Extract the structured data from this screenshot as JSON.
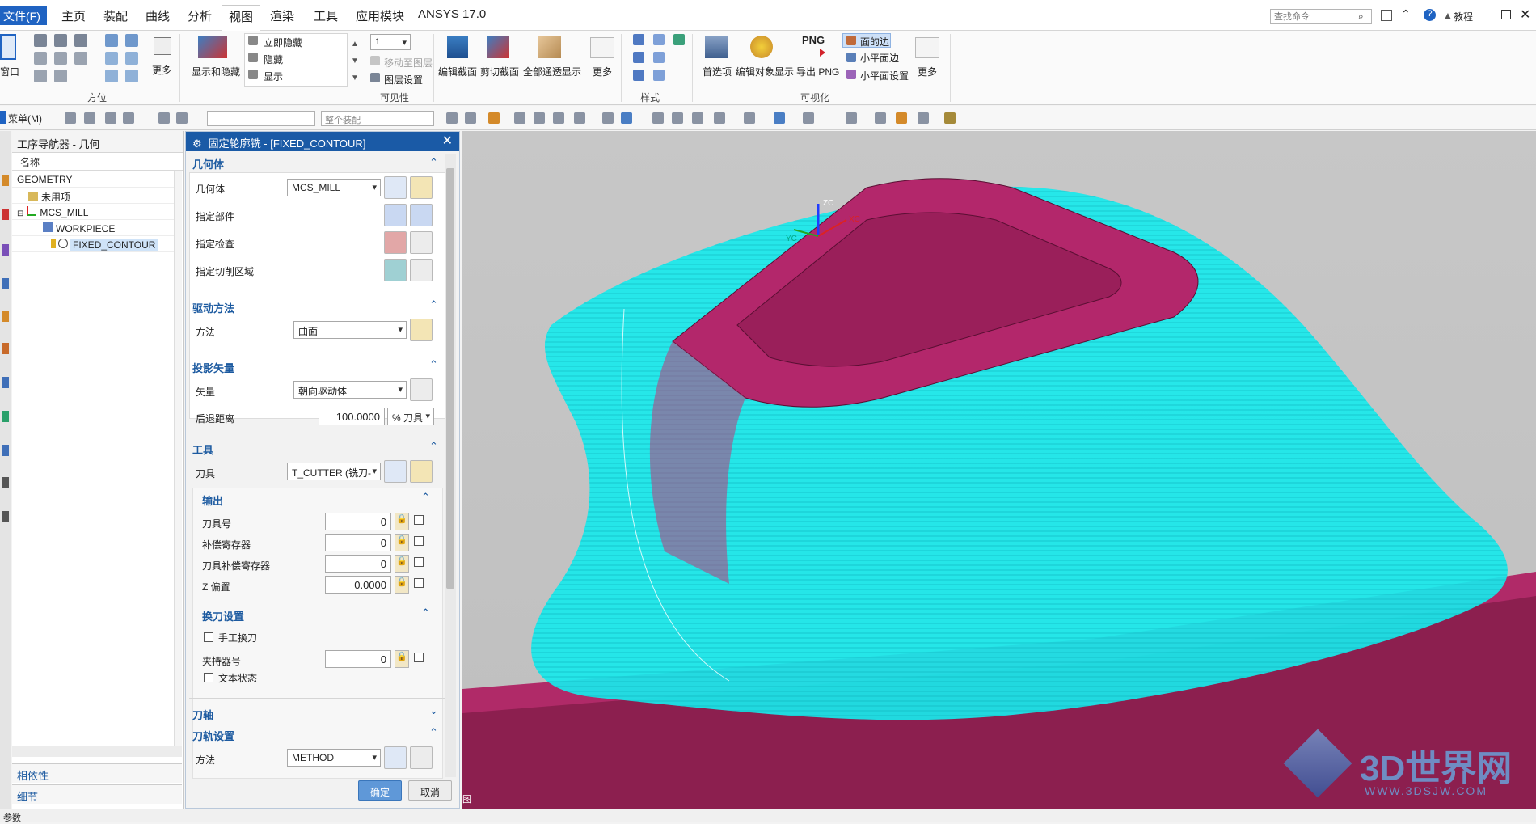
{
  "menubar": {
    "file": "文件(F)",
    "items": [
      "主页",
      "装配",
      "曲线",
      "分析",
      "视图",
      "渲染",
      "工具",
      "应用模块",
      "ANSYS 17.0"
    ],
    "active": "视图",
    "search_placeholder": "查找命令",
    "help": "教程"
  },
  "ribbon": {
    "window_label": "窗口",
    "orient": {
      "more": "更多",
      "label": "方位"
    },
    "visibility": {
      "show_hide": "显示和隐藏",
      "immediate_hide": "立即隐藏",
      "hide": "隐藏",
      "show": "显示",
      "layer_value": "1",
      "move_to_layer": "移动至图层",
      "layer_settings": "图层设置",
      "label": "可见性"
    },
    "sections": {
      "edit_section": "编辑截面",
      "clip_section": "剪切截面",
      "all_through": "全部通透显示",
      "more": "更多"
    },
    "style": {
      "label": "样式"
    },
    "visual": {
      "prefs": "首选项",
      "edit_obj": "编辑对象显示",
      "export_png_icon": "PNG",
      "export_png": "导出 PNG",
      "face_edges": "面的边",
      "small_faces": "小平面边",
      "small_face_settings": "小平面设置",
      "more": "更多",
      "label": "可视化"
    }
  },
  "toolbar2": {
    "menu": "菜单(M)",
    "assembly_combo": "整个装配"
  },
  "navigator": {
    "title": "工序导航器 - 几何",
    "column": "名称",
    "rows": [
      {
        "label": "GEOMETRY",
        "indent": 0
      },
      {
        "label": "未用项",
        "indent": 1
      },
      {
        "label": "MCS_MILL",
        "indent": 1
      },
      {
        "label": "WORKPIECE",
        "indent": 2
      },
      {
        "label": "FIXED_CONTOUR",
        "indent": 3
      }
    ],
    "dependency": "相依性",
    "details": "细节"
  },
  "dialog": {
    "title": "固定轮廓铣 - [FIXED_CONTOUR]",
    "geometry": {
      "header": "几何体",
      "geom_label": "几何体",
      "geom_value": "MCS_MILL",
      "part": "指定部件",
      "check": "指定检查",
      "cut_area": "指定切削区域"
    },
    "drive": {
      "header": "驱动方法",
      "method_label": "方法",
      "method_value": "曲面"
    },
    "projection": {
      "header": "投影矢量",
      "vector_label": "矢量",
      "vector_value": "朝向驱动体",
      "retract_label": "后退距离",
      "retract_value": "100.0000",
      "retract_unit": "% 刀具"
    },
    "tool": {
      "header": "工具",
      "tool_label": "刀具",
      "tool_value": "T_CUTTER (铣刀-",
      "output": {
        "header": "输出",
        "tool_number": "刀具号",
        "tool_number_value": "0",
        "adjust_register": "补偿寄存器",
        "adjust_register_value": "0",
        "cutcom_register": "刀具补偿寄存器",
        "cutcom_register_value": "0",
        "z_offset": "Z 偏置",
        "z_offset_value": "0.0000"
      },
      "change": {
        "header": "换刀设置",
        "manual": "手工换刀",
        "holder": "夹持器号",
        "holder_value": "0",
        "text_status": "文本状态"
      }
    },
    "axis": {
      "header": "刀轴"
    },
    "path": {
      "header": "刀轨设置",
      "method_label": "方法",
      "method_value": "METHOD"
    },
    "ok": "确定",
    "cancel": "取消"
  },
  "viewport": {
    "watermark_main": "3D世界网",
    "watermark_sub": "WWW.3DSJW.COM",
    "axis_zc": "ZC",
    "axis_yc": "YC",
    "axis_xc": "XC",
    "corner_text": "图"
  },
  "status": {
    "text": "参数"
  },
  "colors": {
    "toolpath": "#00f0f0",
    "part": "#b8226a",
    "accent": "#1a5aa6"
  }
}
